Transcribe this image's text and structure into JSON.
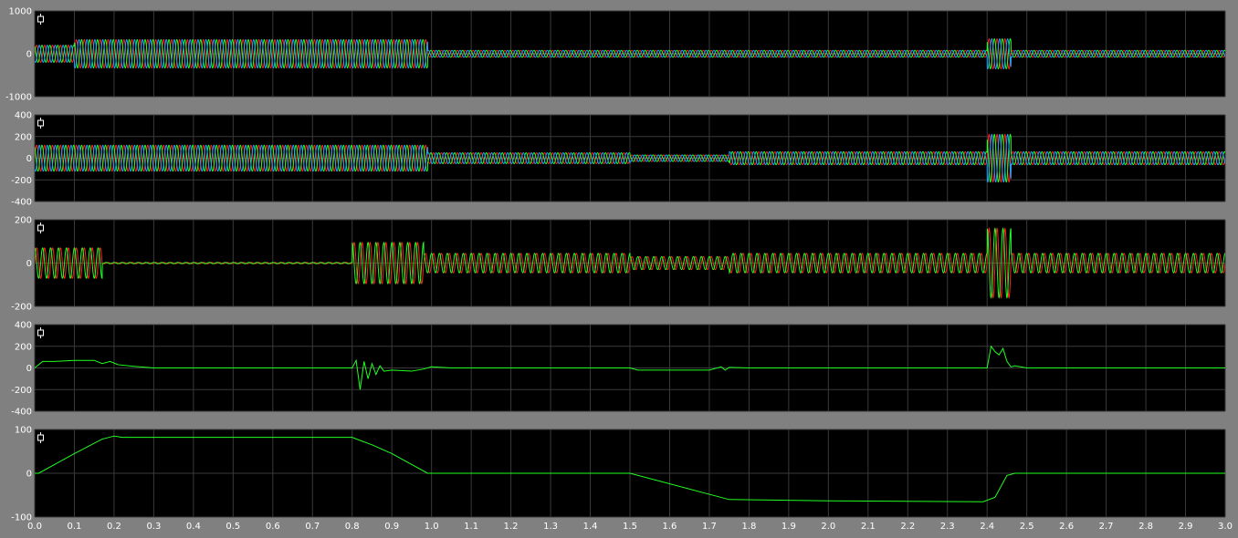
{
  "chart_data": [
    {
      "type": "line",
      "ylim": [
        -1000,
        1000
      ],
      "yticks": [
        -1000,
        0,
        1000
      ],
      "grid": true,
      "series": [
        {
          "color": "#ff2020",
          "kind": "ac",
          "phase": 0,
          "segments": [
            [
              0.0,
              0.1,
              200
            ],
            [
              0.1,
              0.99,
              330
            ],
            [
              0.99,
              2.4,
              80
            ],
            [
              2.4,
              2.46,
              350
            ],
            [
              2.46,
              3.0,
              80
            ]
          ]
        },
        {
          "color": "#20ff20",
          "kind": "ac",
          "phase": 2.094,
          "segments": [
            [
              0.0,
              0.1,
              200
            ],
            [
              0.1,
              0.99,
              330
            ],
            [
              0.99,
              2.4,
              80
            ],
            [
              2.4,
              2.46,
              350
            ],
            [
              2.46,
              3.0,
              80
            ]
          ]
        },
        {
          "color": "#20a0ff",
          "kind": "ac",
          "phase": 4.189,
          "segments": [
            [
              0.0,
              0.1,
              200
            ],
            [
              0.1,
              0.99,
              330
            ],
            [
              0.99,
              2.4,
              80
            ],
            [
              2.4,
              2.46,
              350
            ],
            [
              2.46,
              3.0,
              80
            ]
          ]
        }
      ]
    },
    {
      "type": "line",
      "ylim": [
        -400,
        400
      ],
      "yticks": [
        -400,
        -200,
        0,
        200,
        400
      ],
      "grid": true,
      "series": [
        {
          "color": "#ff2020",
          "kind": "ac",
          "phase": 0,
          "segments": [
            [
              0.0,
              0.99,
              120
            ],
            [
              0.99,
              1.5,
              50
            ],
            [
              1.5,
              1.75,
              30
            ],
            [
              1.75,
              2.4,
              60
            ],
            [
              2.4,
              2.46,
              220
            ],
            [
              2.46,
              3.0,
              60
            ]
          ]
        },
        {
          "color": "#20ff20",
          "kind": "ac",
          "phase": 2.094,
          "segments": [
            [
              0.0,
              0.99,
              120
            ],
            [
              0.99,
              1.5,
              50
            ],
            [
              1.5,
              1.75,
              30
            ],
            [
              1.75,
              2.4,
              60
            ],
            [
              2.4,
              2.46,
              220
            ],
            [
              2.46,
              3.0,
              60
            ]
          ]
        },
        {
          "color": "#20a0ff",
          "kind": "ac",
          "phase": 4.189,
          "segments": [
            [
              0.0,
              0.99,
              120
            ],
            [
              0.99,
              1.5,
              50
            ],
            [
              1.5,
              1.75,
              30
            ],
            [
              1.75,
              2.4,
              60
            ],
            [
              2.4,
              2.46,
              220
            ],
            [
              2.46,
              3.0,
              60
            ]
          ]
        }
      ]
    },
    {
      "type": "line",
      "ylim": [
        -200,
        200
      ],
      "yticks": [
        -200,
        0,
        200
      ],
      "grid": true,
      "series": [
        {
          "color": "#ff2020",
          "kind": "ac",
          "phase": 0,
          "segments": [
            [
              0.0,
              0.17,
              70
            ],
            [
              0.17,
              0.8,
              3
            ],
            [
              0.8,
              0.98,
              95
            ],
            [
              0.98,
              1.5,
              45
            ],
            [
              1.5,
              1.75,
              30
            ],
            [
              1.75,
              2.4,
              45
            ],
            [
              2.4,
              2.46,
              160
            ],
            [
              2.46,
              3.0,
              45
            ]
          ]
        },
        {
          "color": "#20ff20",
          "kind": "ac",
          "phase": 1.571,
          "segments": [
            [
              0.0,
              0.17,
              70
            ],
            [
              0.17,
              0.8,
              3
            ],
            [
              0.8,
              0.98,
              95
            ],
            [
              0.98,
              1.5,
              45
            ],
            [
              1.5,
              1.75,
              30
            ],
            [
              1.75,
              2.4,
              45
            ],
            [
              2.4,
              2.46,
              160
            ],
            [
              2.46,
              3.0,
              45
            ]
          ]
        }
      ]
    },
    {
      "type": "line",
      "ylim": [
        -400,
        400
      ],
      "yticks": [
        -400,
        -200,
        0,
        200,
        400
      ],
      "grid": true,
      "series": [
        {
          "color": "#20ff20",
          "kind": "pts",
          "x": [
            0.0,
            0.02,
            0.05,
            0.1,
            0.15,
            0.17,
            0.19,
            0.21,
            0.25,
            0.3,
            0.8,
            0.81,
            0.82,
            0.83,
            0.84,
            0.85,
            0.86,
            0.87,
            0.88,
            0.9,
            0.95,
            0.98,
            1.0,
            1.05,
            1.5,
            1.52,
            1.7,
            1.73,
            1.74,
            1.75,
            1.8,
            2.4,
            2.41,
            2.42,
            2.43,
            2.44,
            2.45,
            2.46,
            2.47,
            2.5,
            3.0
          ],
          "y": [
            0,
            60,
            60,
            70,
            70,
            40,
            60,
            30,
            15,
            0,
            0,
            70,
            -200,
            60,
            -100,
            40,
            -60,
            20,
            -30,
            -20,
            -30,
            -10,
            10,
            0,
            0,
            -20,
            -20,
            10,
            -20,
            5,
            0,
            0,
            200,
            150,
            120,
            180,
            60,
            10,
            20,
            0,
            0
          ]
        }
      ]
    },
    {
      "type": "line",
      "ylim": [
        -100,
        100
      ],
      "yticks": [
        -100,
        0,
        100
      ],
      "grid": true,
      "series": [
        {
          "color": "#20ff20",
          "kind": "pts",
          "x": [
            0.0,
            0.01,
            0.05,
            0.1,
            0.17,
            0.2,
            0.22,
            0.25,
            0.8,
            0.82,
            0.85,
            0.9,
            0.99,
            1.0,
            1.5,
            1.75,
            2.0,
            2.39,
            2.42,
            2.45,
            2.47,
            3.0
          ],
          "y": [
            0,
            0,
            20,
            45,
            78,
            85,
            82,
            82,
            82,
            75,
            65,
            45,
            0,
            0,
            0,
            -60,
            -63,
            -65,
            -55,
            -5,
            0,
            0
          ]
        }
      ]
    }
  ],
  "x_axis": {
    "ticks": [
      "0.0",
      "0.1",
      "0.2",
      "0.3",
      "0.4",
      "0.5",
      "0.6",
      "0.7",
      "0.8",
      "0.9",
      "1.0",
      "1.1",
      "1.2",
      "1.3",
      "1.4",
      "1.5",
      "1.6",
      "1.7",
      "1.8",
      "1.9",
      "2.0",
      "2.1",
      "2.2",
      "2.3",
      "2.4",
      "2.5",
      "2.6",
      "2.7",
      "2.8",
      "2.9",
      "3.0"
    ],
    "xlim": [
      0,
      3.0
    ],
    "frequency_hz": 50
  },
  "colors": {
    "background": "#808080",
    "plot": "#000000",
    "grid": "#3a3a3a",
    "text": "#ffffff"
  },
  "icons": [
    "scope-cursor-icon"
  ]
}
